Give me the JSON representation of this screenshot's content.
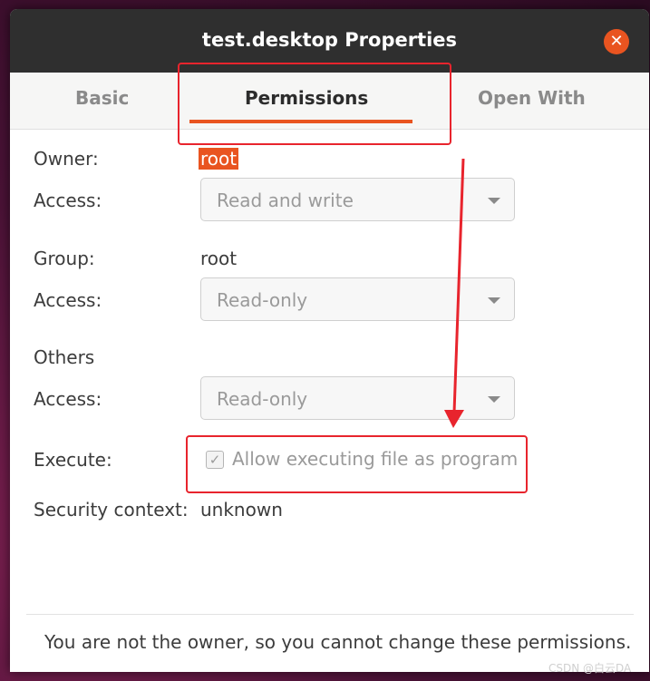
{
  "window": {
    "title": "test.desktop Properties",
    "close_label": "✕"
  },
  "tabs": [
    {
      "label": "Basic",
      "active": false
    },
    {
      "label": "Permissions",
      "active": true
    },
    {
      "label": "Open With",
      "active": false
    }
  ],
  "owner": {
    "label": "Owner:",
    "value": "root",
    "access_label": "Access:",
    "access_value": "Read and write"
  },
  "group": {
    "label": "Group:",
    "value": "root",
    "access_label": "Access:",
    "access_value": "Read-only"
  },
  "others": {
    "label": "Others",
    "access_label": "Access:",
    "access_value": "Read-only"
  },
  "execute": {
    "label": "Execute:",
    "checkbox_label": "Allow executing file as program",
    "checked": true,
    "check_glyph": "✓"
  },
  "security": {
    "label": "Security context:",
    "value": "unknown"
  },
  "footer": {
    "note": "You are not the owner, so you cannot change these permissions."
  },
  "watermark": "CSDN @白云DA",
  "colors": {
    "accent": "#e95420",
    "annotation": "#e8242d",
    "titlebar": "#2f2f2f"
  }
}
